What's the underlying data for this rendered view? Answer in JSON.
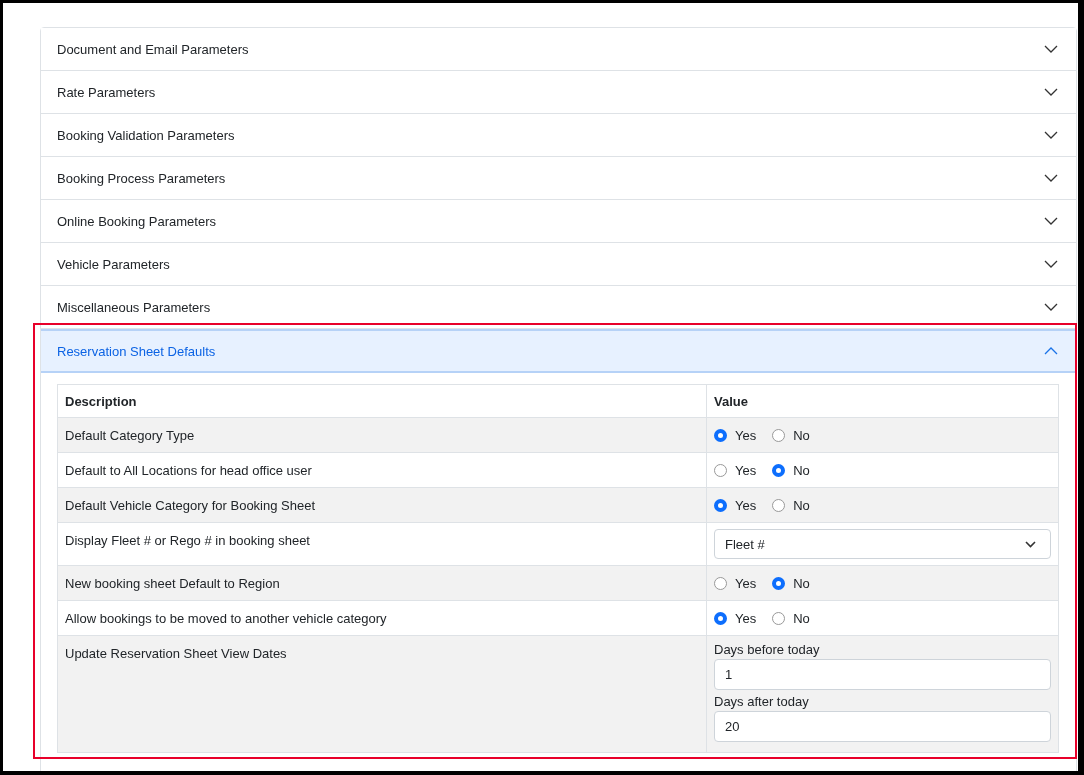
{
  "sections": [
    {
      "title": "Document and Email Parameters",
      "expanded": false,
      "highlighted": false
    },
    {
      "title": "Rate Parameters",
      "expanded": false,
      "highlighted": false
    },
    {
      "title": "Booking Validation Parameters",
      "expanded": false,
      "highlighted": false
    },
    {
      "title": "Booking Process Parameters",
      "expanded": false,
      "highlighted": false
    },
    {
      "title": "Online Booking Parameters",
      "expanded": false,
      "highlighted": false
    },
    {
      "title": "Vehicle Parameters",
      "expanded": false,
      "highlighted": false
    },
    {
      "title": "Miscellaneous Parameters",
      "expanded": false,
      "highlighted": false
    },
    {
      "title": "Reservation Sheet Defaults",
      "expanded": true,
      "highlighted": true,
      "table": {
        "columns": [
          "Description",
          "Value"
        ],
        "rows": [
          {
            "description": "Default Category Type",
            "kind": "radio",
            "options": [
              {
                "label": "Yes",
                "selected": true
              },
              {
                "label": "No",
                "selected": false
              }
            ]
          },
          {
            "description": "Default to All Locations for head office user",
            "kind": "radio",
            "options": [
              {
                "label": "Yes",
                "selected": false
              },
              {
                "label": "No",
                "selected": true
              }
            ]
          },
          {
            "description": "Default Vehicle Category for Booking Sheet",
            "kind": "radio",
            "options": [
              {
                "label": "Yes",
                "selected": true
              },
              {
                "label": "No",
                "selected": false
              }
            ]
          },
          {
            "description": "Display Fleet # or Rego # in booking sheet",
            "kind": "select",
            "value": "Fleet #"
          },
          {
            "description": "New booking sheet Default to Region",
            "kind": "radio",
            "options": [
              {
                "label": "Yes",
                "selected": false
              },
              {
                "label": "No",
                "selected": true
              }
            ]
          },
          {
            "description": "Allow bookings to be moved to another vehicle category",
            "kind": "radio",
            "options": [
              {
                "label": "Yes",
                "selected": true
              },
              {
                "label": "No",
                "selected": false
              }
            ]
          },
          {
            "description": "Update Reservation Sheet View Dates",
            "kind": "fields",
            "fields": [
              {
                "label": "Days before today",
                "value": "1"
              },
              {
                "label": "Days after today",
                "value": "20"
              }
            ]
          }
        ]
      }
    }
  ]
}
